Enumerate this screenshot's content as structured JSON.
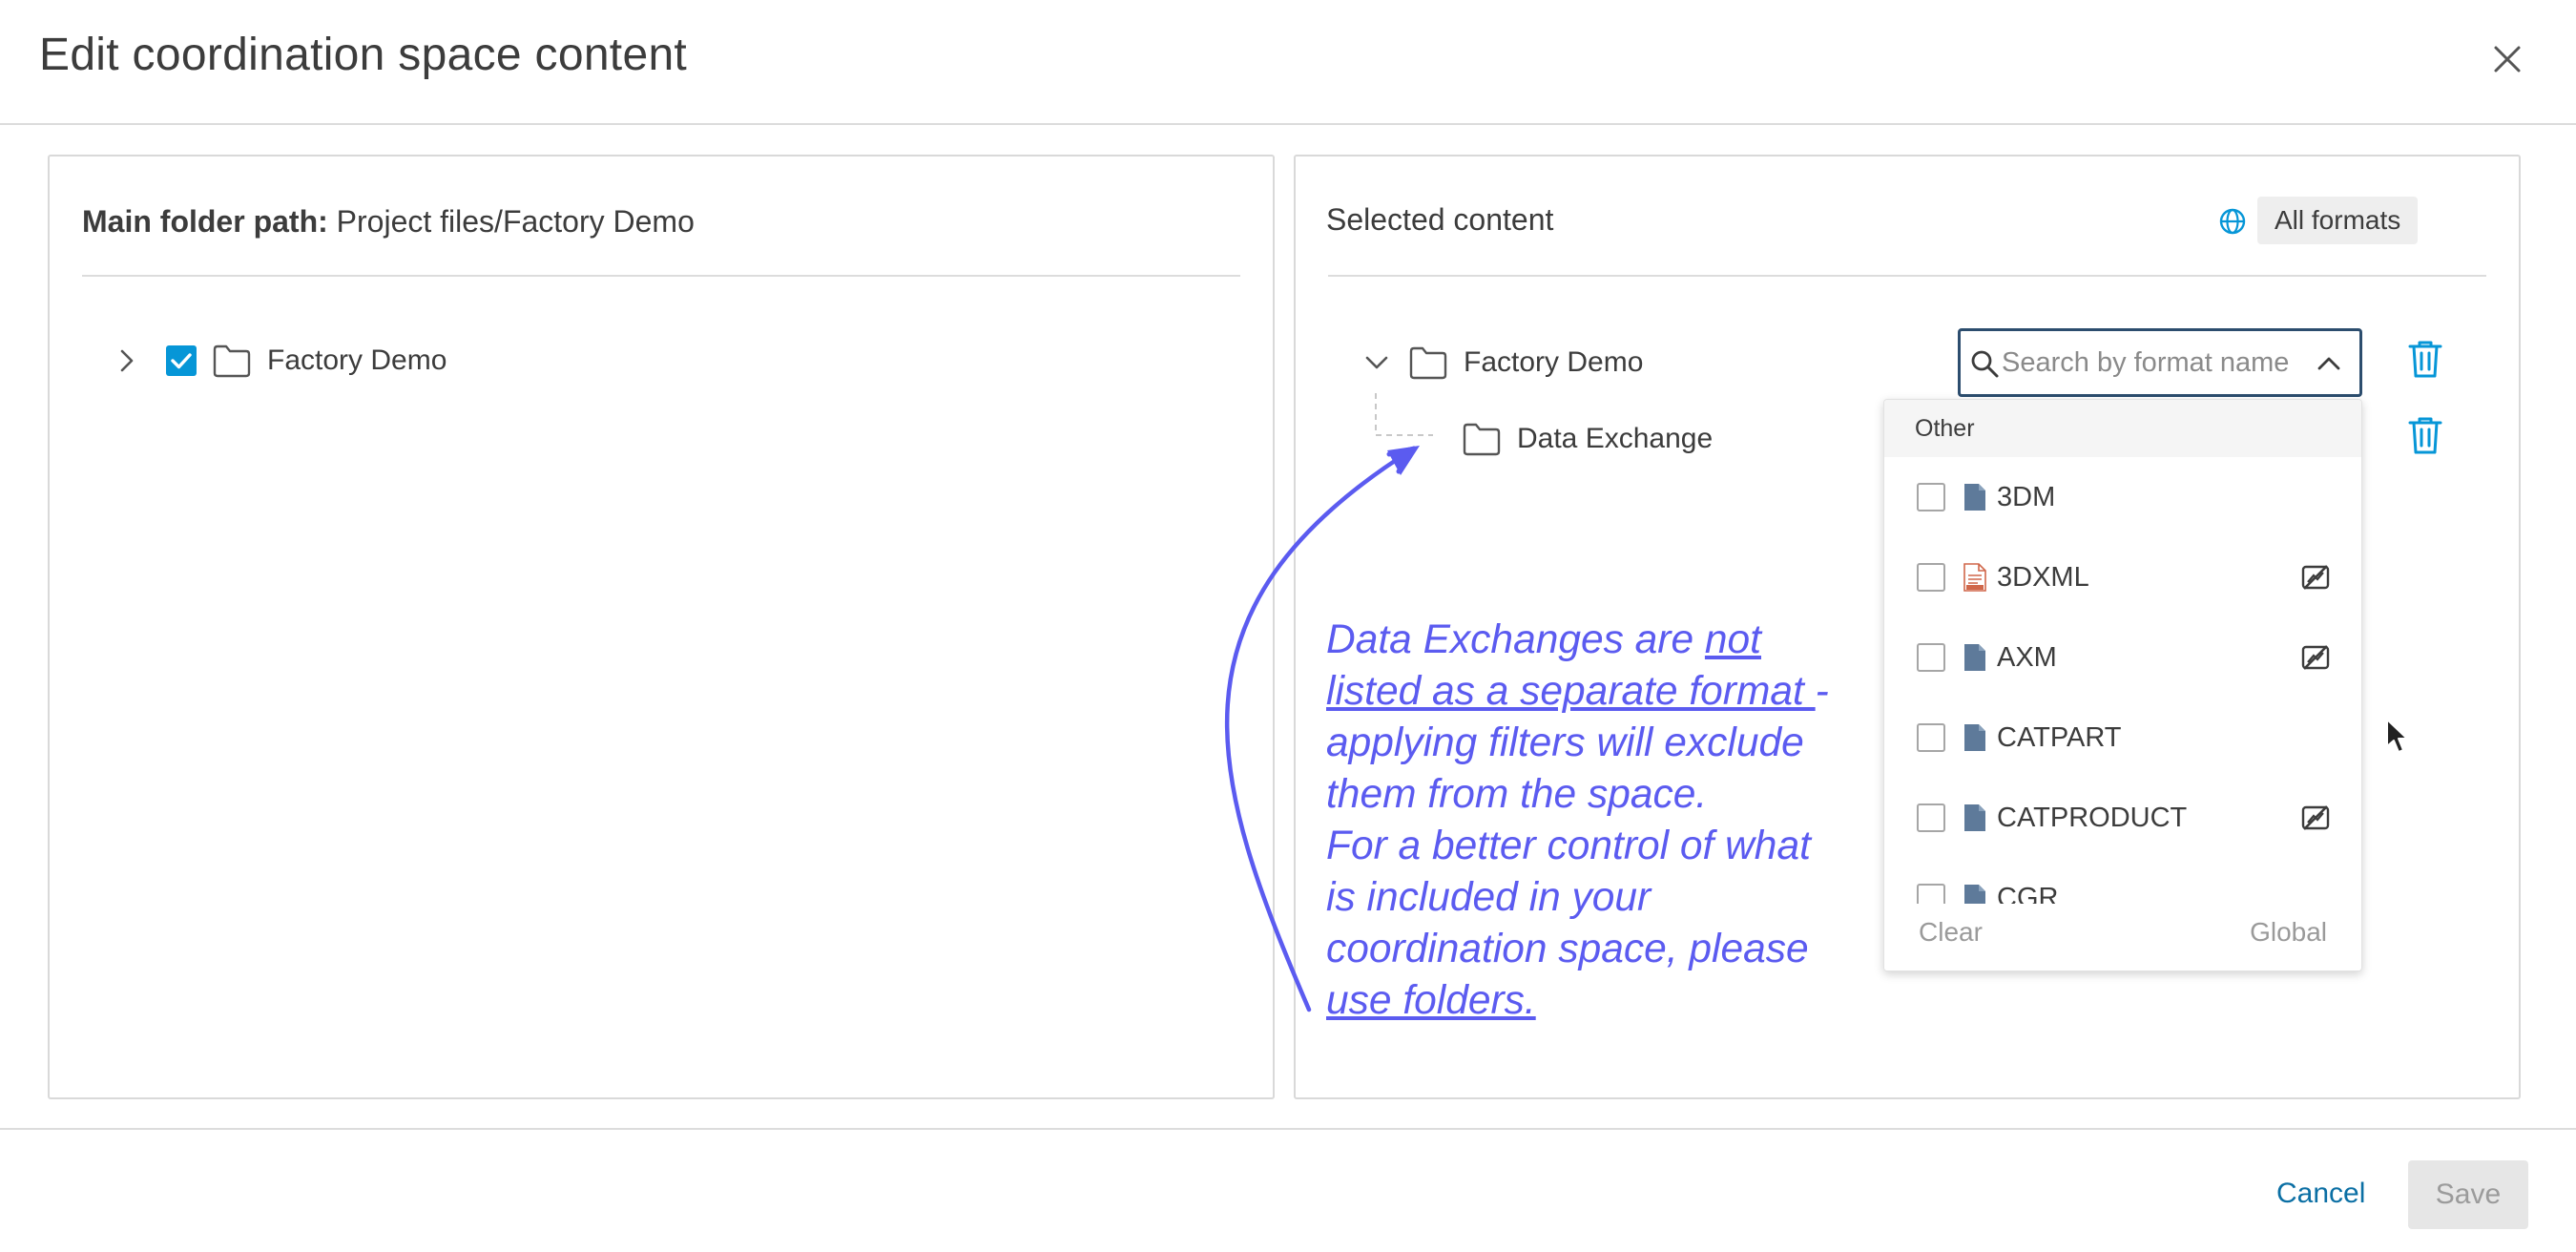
{
  "dialog": {
    "title": "Edit coordination space content",
    "close_icon": "close-icon"
  },
  "left_panel": {
    "path_label": "Main folder path:",
    "path_value": "Project files/Factory Demo",
    "tree": [
      {
        "label": "Factory Demo",
        "checked": true,
        "expanded": false
      }
    ]
  },
  "right_panel": {
    "title": "Selected content",
    "formats_chip": "All formats",
    "tree": [
      {
        "label": "Factory Demo",
        "expanded": true
      },
      {
        "label": "Data Exchange",
        "level": 1
      }
    ],
    "search": {
      "value": "",
      "placeholder": "Search by format name"
    },
    "dropdown": {
      "group": "Other",
      "items": [
        {
          "label": "3DM",
          "checked": false,
          "file_icon": "file-icon",
          "badge": ""
        },
        {
          "label": "3DXML",
          "checked": false,
          "file_icon": "document-icon",
          "badge": "no-preview-icon"
        },
        {
          "label": "AXM",
          "checked": false,
          "file_icon": "file-icon",
          "badge": "no-preview-icon"
        },
        {
          "label": "CATPART",
          "checked": false,
          "file_icon": "file-icon",
          "badge": ""
        },
        {
          "label": "CATPRODUCT",
          "checked": false,
          "file_icon": "file-icon",
          "badge": "no-preview-icon"
        },
        {
          "label": "CGR",
          "checked": false,
          "file_icon": "file-icon",
          "badge": ""
        }
      ],
      "clear_label": "Clear",
      "global_label": "Global"
    }
  },
  "annotation": {
    "line1_a": "Data Exchanges are ",
    "line1_b": "not",
    "line2_a": "listed as a separate format ",
    "line2_b": "-",
    "line3": "applying filters will exclude",
    "line4": "them from the space.",
    "line5": "For a better control of what",
    "line6": "is included in your",
    "line7": "coordination space, please",
    "line8": "use folders."
  },
  "footer": {
    "cancel_label": "Cancel",
    "save_label": "Save"
  },
  "colors": {
    "accent": "#0696d7",
    "link": "#0b6fa4",
    "annotation": "#5b5bf0",
    "search_border": "#2c4d6e"
  }
}
